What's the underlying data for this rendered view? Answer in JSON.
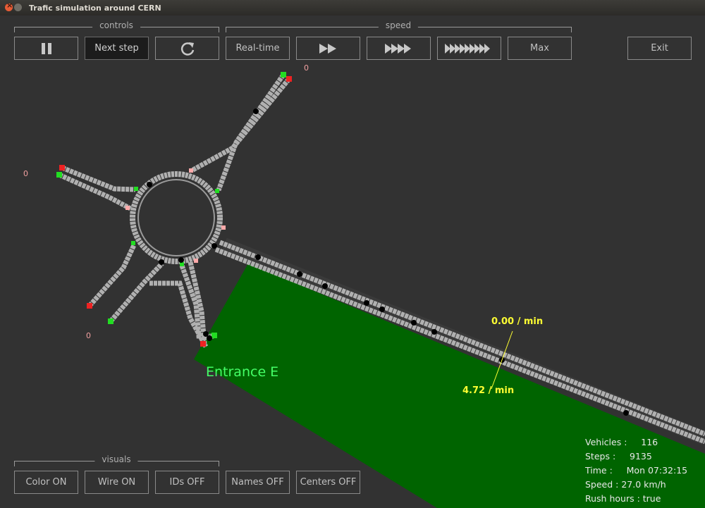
{
  "window": {
    "title": "Trafic simulation around CERN"
  },
  "controls": {
    "group_label": "controls",
    "pause_icon": "pause-icon",
    "next_step_label": "Next step",
    "restart_icon": "refresh-icon"
  },
  "speed": {
    "group_label": "speed",
    "realtime_label": "Real-time",
    "fast_icon": "fast-forward-2-icon",
    "faster_icon": "fast-forward-4-icon",
    "fastest_icon": "fast-forward-9-icon",
    "max_label": "Max"
  },
  "exit_label": "Exit",
  "visuals": {
    "group_label": "visuals",
    "color_label": "Color ON",
    "wire_label": "Wire ON",
    "ids_label": "IDs OFF",
    "names_label": "Names OFF",
    "centers_label": "Centers OFF"
  },
  "map": {
    "counter_top": "0",
    "counter_left": "0",
    "counter_bottom": "0",
    "rate_in": "0.00 / min",
    "rate_out": "4.72 / min",
    "entrance_label": "Entrance E",
    "colors": {
      "zone": "#006400",
      "road": "#9a9a9a",
      "rate": "#ffff33",
      "light_green": "#22dd22",
      "light_red": "#ee2222"
    }
  },
  "stats": {
    "vehicles": "Vehicles :     116",
    "steps": "Steps :     9135",
    "time": "Time :     Mon 07:32:15",
    "speed": "Speed : 27.0 km/h",
    "rush": "Rush hours : true"
  }
}
